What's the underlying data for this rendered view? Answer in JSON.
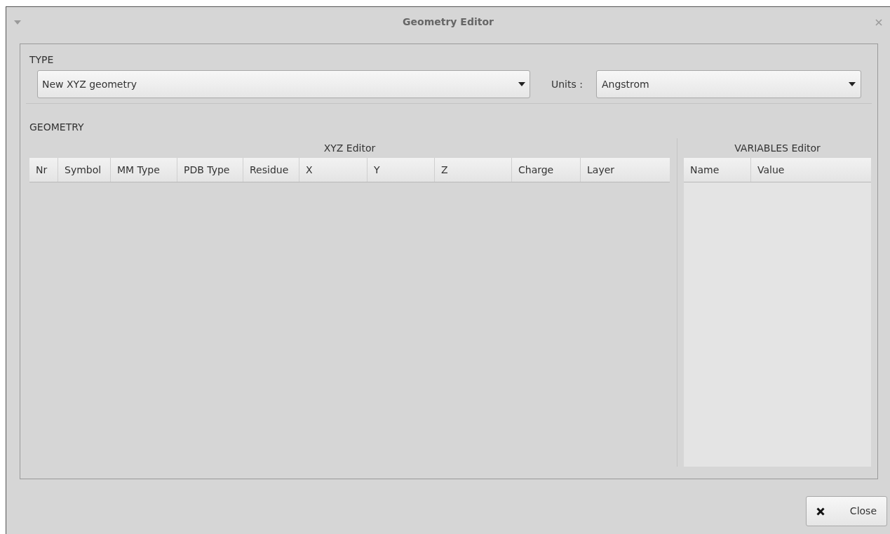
{
  "window": {
    "title": "Geometry Editor"
  },
  "type_section": {
    "label": "TYPE",
    "type_select": {
      "value": "New XYZ geometry"
    },
    "units_label": "Units :",
    "units_select": {
      "value": "Angstrom"
    }
  },
  "geometry_section": {
    "label": "GEOMETRY",
    "xyz_editor": {
      "title": "XYZ Editor",
      "columns": [
        "Nr",
        "Symbol",
        "MM Type",
        "PDB Type",
        "Residue",
        "X",
        "Y",
        "Z",
        "Charge",
        "Layer"
      ]
    },
    "variables_editor": {
      "title": "VARIABLES Editor",
      "columns": [
        "Name",
        "Value"
      ]
    }
  },
  "buttons": [
    {
      "label": "Close"
    }
  ]
}
